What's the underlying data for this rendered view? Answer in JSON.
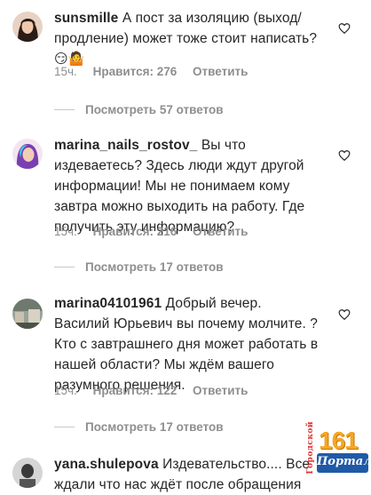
{
  "comments": [
    {
      "username": "sunsmille",
      "text": "А пост за изоляцию (выход/ продление) может тоже стоит написать?",
      "emoji": "😏🤷",
      "time": "15ч.",
      "likes": "Нравится: 276",
      "reply": "Ответить",
      "view_replies": "Посмотреть 57 ответов"
    },
    {
      "username": "marina_nails_rostov_",
      "text": "Вы что издеваетесь? Здесь люди ждут другой информации! Мы не понимаем кому завтра можно выходить на работу. Где получить эту информацию?",
      "time": "15ч.",
      "likes": "Нравится: 216",
      "reply": "Ответить",
      "view_replies": "Посмотреть 17 ответов"
    },
    {
      "username": "marina04101961",
      "text": "Добрый вечер. Василий Юрьевич вы почему молчите. ? Кто с завтрашнего дня может работать в нашей области? Мы ждём вашего разумного решения.",
      "time": "15ч.",
      "likes": "Нравится: 122",
      "reply": "Ответить",
      "view_replies": "Посмотреть 17 ответов"
    },
    {
      "username": "yana.shulepova",
      "text": "Издевательство.... Все ждали что нас ждёт после обращения"
    }
  ],
  "watermark": {
    "number": "161",
    "word": "Портал",
    "vertical": "Городской"
  }
}
